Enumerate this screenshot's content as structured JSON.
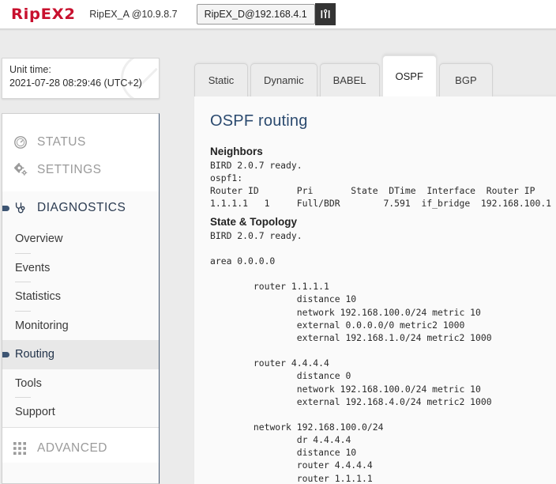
{
  "header": {
    "logo": "RipEX2",
    "unit_a_label": "RipEX_A @10.9.8.7",
    "unit_d_label": "RipEX_D@192.168.4.1",
    "unit_icon": "antenna-icon"
  },
  "unit_time": {
    "label": "Unit time:",
    "value": "2021-07-28 08:29:46 (UTC+2)"
  },
  "sidebar": {
    "groups": [
      {
        "label": "STATUS",
        "icon": "gauge-icon",
        "active": false
      },
      {
        "label": "SETTINGS",
        "icon": "gears-icon",
        "active": false
      },
      {
        "label": "DIAGNOSTICS",
        "icon": "stethoscope-icon",
        "active": true
      },
      {
        "label": "ADVANCED",
        "icon": "grid-icon",
        "active": false
      }
    ],
    "items": [
      {
        "label": "Overview",
        "selected": false
      },
      {
        "label": "Events",
        "selected": false
      },
      {
        "label": "Statistics",
        "selected": false
      },
      {
        "label": "Monitoring",
        "selected": false
      },
      {
        "label": "Routing",
        "selected": true
      },
      {
        "label": "Tools",
        "selected": false
      },
      {
        "label": "Support",
        "selected": false
      }
    ]
  },
  "main": {
    "tabs": [
      {
        "label": "Static",
        "active": false
      },
      {
        "label": "Dynamic",
        "active": false
      },
      {
        "label": "BABEL",
        "active": false
      },
      {
        "label": "OSPF",
        "active": true
      },
      {
        "label": "BGP",
        "active": false
      }
    ],
    "page_title": "OSPF routing",
    "sections": [
      {
        "heading": "Neighbors",
        "body": "BIRD 2.0.7 ready.\nospf1:\nRouter ID\tPri\t  State\t DTime  Interface  Router IP\n1.1.1.1\t  1\tFull/BDR\t7.591  if_bridge  192.168.100.1"
      },
      {
        "heading": "State & Topology",
        "body": "BIRD 2.0.7 ready.\n\narea 0.0.0.0\n\n\trouter 1.1.1.1\n\t\tdistance 10\n\t\tnetwork 192.168.100.0/24 metric 10\n\t\texternal 0.0.0.0/0 metric2 1000\n\t\texternal 192.168.1.0/24 metric2 1000\n\n\trouter 4.4.4.4\n\t\tdistance 0\n\t\tnetwork 192.168.100.0/24 metric 10\n\t\texternal 192.168.4.0/24 metric2 1000\n\n\tnetwork 192.168.100.0/24\n\t\tdr 4.4.4.4\n\t\tdistance 10\n\t\trouter 4.4.4.4\n\t\trouter 1.1.1.1"
      }
    ],
    "neighbors_table": {
      "columns": [
        "Router ID",
        "Pri",
        "State",
        "DTime",
        "Interface",
        "Router IP"
      ],
      "rows": [
        [
          "1.1.1.1",
          "1",
          "Full/BDR",
          "7.591",
          "if_bridge",
          "192.168.100.1"
        ]
      ],
      "preamble": [
        "BIRD 2.0.7 ready.",
        "ospf1:"
      ]
    }
  },
  "colors": {
    "brand_red": "#c8102e",
    "title_blue": "#2b4a6f",
    "accent_marker": "#3d5573"
  }
}
